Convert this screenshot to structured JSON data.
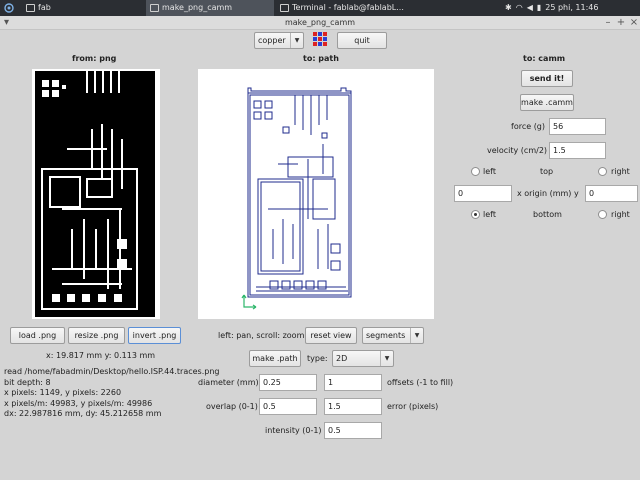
{
  "taskbar": {
    "tasks": [
      {
        "label": "fab"
      },
      {
        "label": "make_png_camm"
      },
      {
        "label": "Terminal - fablab@fablabL..."
      }
    ],
    "clock": "25 phi, 11:46"
  },
  "window": {
    "title": "make_png_camm"
  },
  "toolbar": {
    "format": "copper",
    "quit_label": "quit"
  },
  "left": {
    "header": "from: png",
    "load_label": "load .png",
    "resize_label": "resize .png",
    "invert_label": "invert .png",
    "coords": "x: 19.817 mm  y: 0.113 mm",
    "info": [
      "read /home/fabadmin/Desktop/hello.ISP.44.traces.png",
      "bit depth: 8",
      "x pixels: 1149, y pixels: 2260",
      "x pixels/m: 49983, y pixels/m: 49986",
      "dx: 22.987816 mm, dy: 45.212658 mm"
    ]
  },
  "middle": {
    "header": "to: path",
    "hint": "left: pan, scroll: zoom",
    "reset_label": "reset view",
    "view_mode": "segments",
    "make_path_label": "make .path",
    "type_label": "type:",
    "type_value": "2D",
    "diameter_label": "diameter (mm)",
    "diameter_value": "0.25",
    "offsets_value": "1",
    "offsets_label": "offsets (-1 to fill)",
    "overlap_label": "overlap (0-1)",
    "overlap_value": "0.5",
    "error_value": "1.5",
    "error_label": "error (pixels)",
    "intensity_label": "intensity (0-1)",
    "intensity_value": "0.5"
  },
  "right": {
    "header": "to: camm",
    "send_label": "send it!",
    "make_camm_label": "make .camm",
    "force_label": "force (g)",
    "force_value": "56",
    "velocity_label": "velocity (cm/2)",
    "velocity_value": "1.5",
    "origin_top": {
      "left": "left",
      "mid": "top",
      "right": "right"
    },
    "origin_x_value": "0",
    "origin_label": "x  origin (mm)  y",
    "origin_y_value": "0",
    "origin_bottom": {
      "left": "left",
      "mid": "bottom",
      "right": "right"
    }
  },
  "colors": {
    "path_stroke": "#1f2b8c",
    "accent": "#5b8fd6",
    "taskbar_bg": "#2b2e33"
  }
}
